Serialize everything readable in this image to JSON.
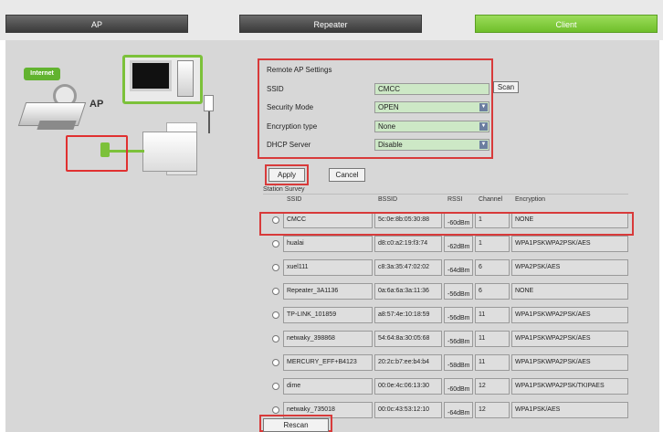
{
  "tabs": [
    {
      "label": "AP",
      "active": false
    },
    {
      "label": "Repeater",
      "active": false
    },
    {
      "label": "Client",
      "active": true
    }
  ],
  "illustration": {
    "internet_label": "Internet",
    "ap_label": "AP"
  },
  "settings": {
    "title": "Remote AP Settings",
    "ssid_label": "SSID",
    "ssid_value": "CMCC",
    "security_label": "Security Mode",
    "security_value": "OPEN",
    "encryption_label": "Encryption type",
    "encryption_value": "None",
    "dhcp_label": "DHCP Server",
    "dhcp_value": "Disable",
    "scan_label": "Scan"
  },
  "buttons": {
    "apply": "Apply",
    "cancel": "Cancel",
    "rescan": "Rescan"
  },
  "survey": {
    "title": "Station Survey",
    "headers": [
      "SSID",
      "BSSID",
      "RSSI",
      "Channel",
      "Encryption"
    ],
    "rows": [
      {
        "ssid": "CMCC",
        "bssid": "5c:0e:8b:05:30:88",
        "rssi": "-60dBm",
        "channel": "1",
        "encryption": "NONE"
      },
      {
        "ssid": "hualai",
        "bssid": "d8:c0:a2:19:f3:74",
        "rssi": "-62dBm",
        "channel": "1",
        "encryption": "WPA1PSKWPA2PSK/AES"
      },
      {
        "ssid": "xuel111",
        "bssid": "c8:3a:35:47:02:02",
        "rssi": "-64dBm",
        "channel": "6",
        "encryption": "WPA2PSK/AES"
      },
      {
        "ssid": "Repeater_3A1136",
        "bssid": "0a:6a:6a:3a:11:36",
        "rssi": "-56dBm",
        "channel": "6",
        "encryption": "NONE"
      },
      {
        "ssid": "TP-LINK_101859",
        "bssid": "a8:57:4e:10:18:59",
        "rssi": "-56dBm",
        "channel": "11",
        "encryption": "WPA1PSKWPA2PSK/AES"
      },
      {
        "ssid": "netwaky_398868",
        "bssid": "54:64:8a:30:05:68",
        "rssi": "-56dBm",
        "channel": "11",
        "encryption": "WPA1PSKWPA2PSK/AES"
      },
      {
        "ssid": "MERCURY_EFF+B4123",
        "bssid": "20:2c:b7:ee:b4:b4",
        "rssi": "-58dBm",
        "channel": "11",
        "encryption": "WPA1PSKWPA2PSK/AES"
      },
      {
        "ssid": "dime",
        "bssid": "00:0e:4c:06:13:30",
        "rssi": "-60dBm",
        "channel": "12",
        "encryption": "WPA1PSKWPA2PSK/TKIPAES"
      },
      {
        "ssid": "netwaky_735018",
        "bssid": "00:0c:43:53:12:10",
        "rssi": "-64dBm",
        "channel": "12",
        "encryption": "WPA1PSK/AES"
      }
    ]
  },
  "colors": {
    "accent_green": "#6fbf2a",
    "highlight_red": "#d83a3a",
    "field_green": "#cde8c6"
  }
}
